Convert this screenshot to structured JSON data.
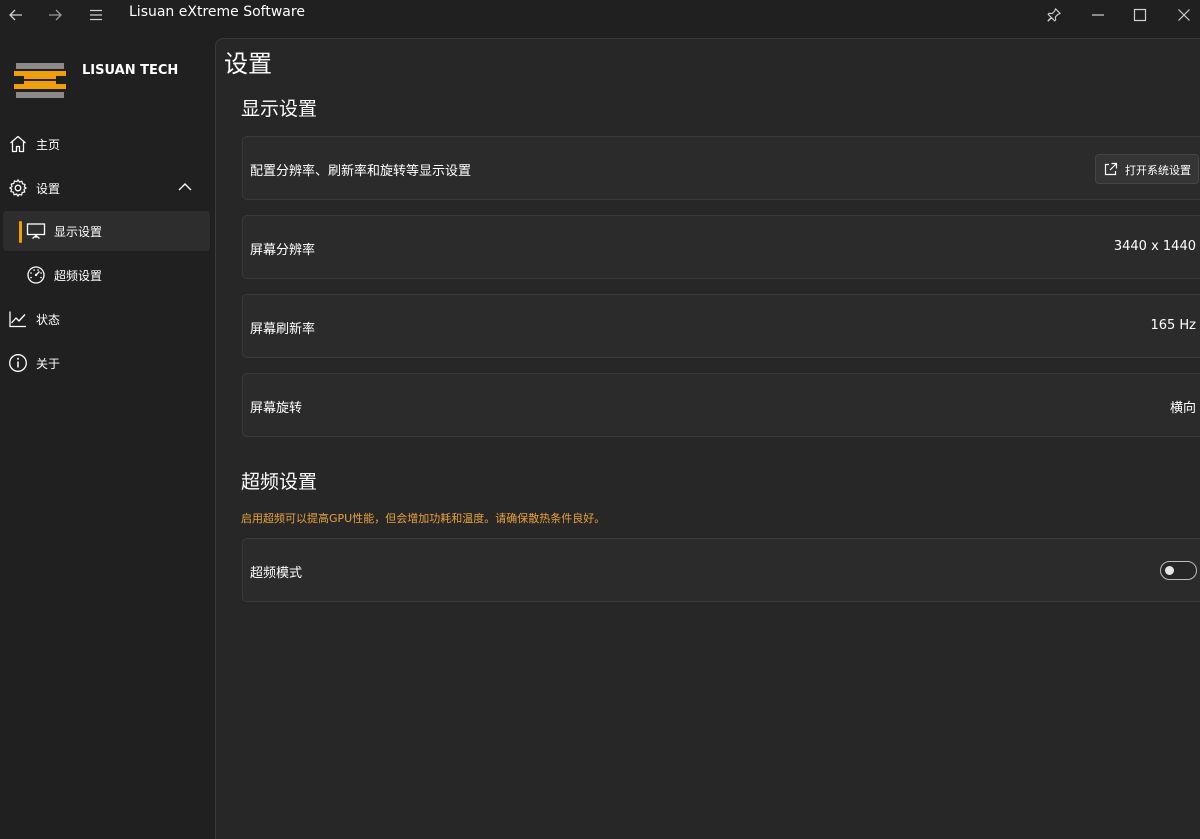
{
  "window": {
    "title": "Lisuan eXtreme Software",
    "icons": [
      "back-arrow-icon",
      "forward-arrow-icon",
      "menu-icon",
      "pin-icon",
      "minimize-icon",
      "maximize-icon",
      "close-icon"
    ]
  },
  "sidebar": {
    "brand": "LISUAN TECH",
    "items": [
      {
        "label": "主页",
        "icon": "home-icon"
      },
      {
        "label": "设置",
        "icon": "gear-icon",
        "expanded": true
      },
      {
        "label": "显示设置",
        "icon": "monitor-icon",
        "selected": true
      },
      {
        "label": "超频设置",
        "icon": "gauge-icon"
      },
      {
        "label": "状态",
        "icon": "chart-line-icon"
      },
      {
        "label": "关于",
        "icon": "info-icon"
      }
    ]
  },
  "main": {
    "title": "设置",
    "display_section": {
      "title": "显示设置",
      "rows": [
        {
          "label": "配置分辨率、刷新率和旋转等显示设置",
          "button": "打开系统设置"
        },
        {
          "label": "屏幕分辨率",
          "value": "3440 x 1440"
        },
        {
          "label": "屏幕刷新率",
          "value": "165 Hz"
        },
        {
          "label": "屏幕旋转",
          "value": "横向"
        }
      ]
    },
    "oc_section": {
      "title": "超频设置",
      "warning": "启用超频可以提高GPU性能，但会增加功耗和温度。请确保散热条件良好。",
      "rows": [
        {
          "label": "超频模式",
          "toggle_on": false
        }
      ]
    }
  },
  "colors": {
    "accent": "#f0a000",
    "warning_text": "#e8a23a",
    "background": "#202020",
    "card": "#2b2b2b"
  }
}
